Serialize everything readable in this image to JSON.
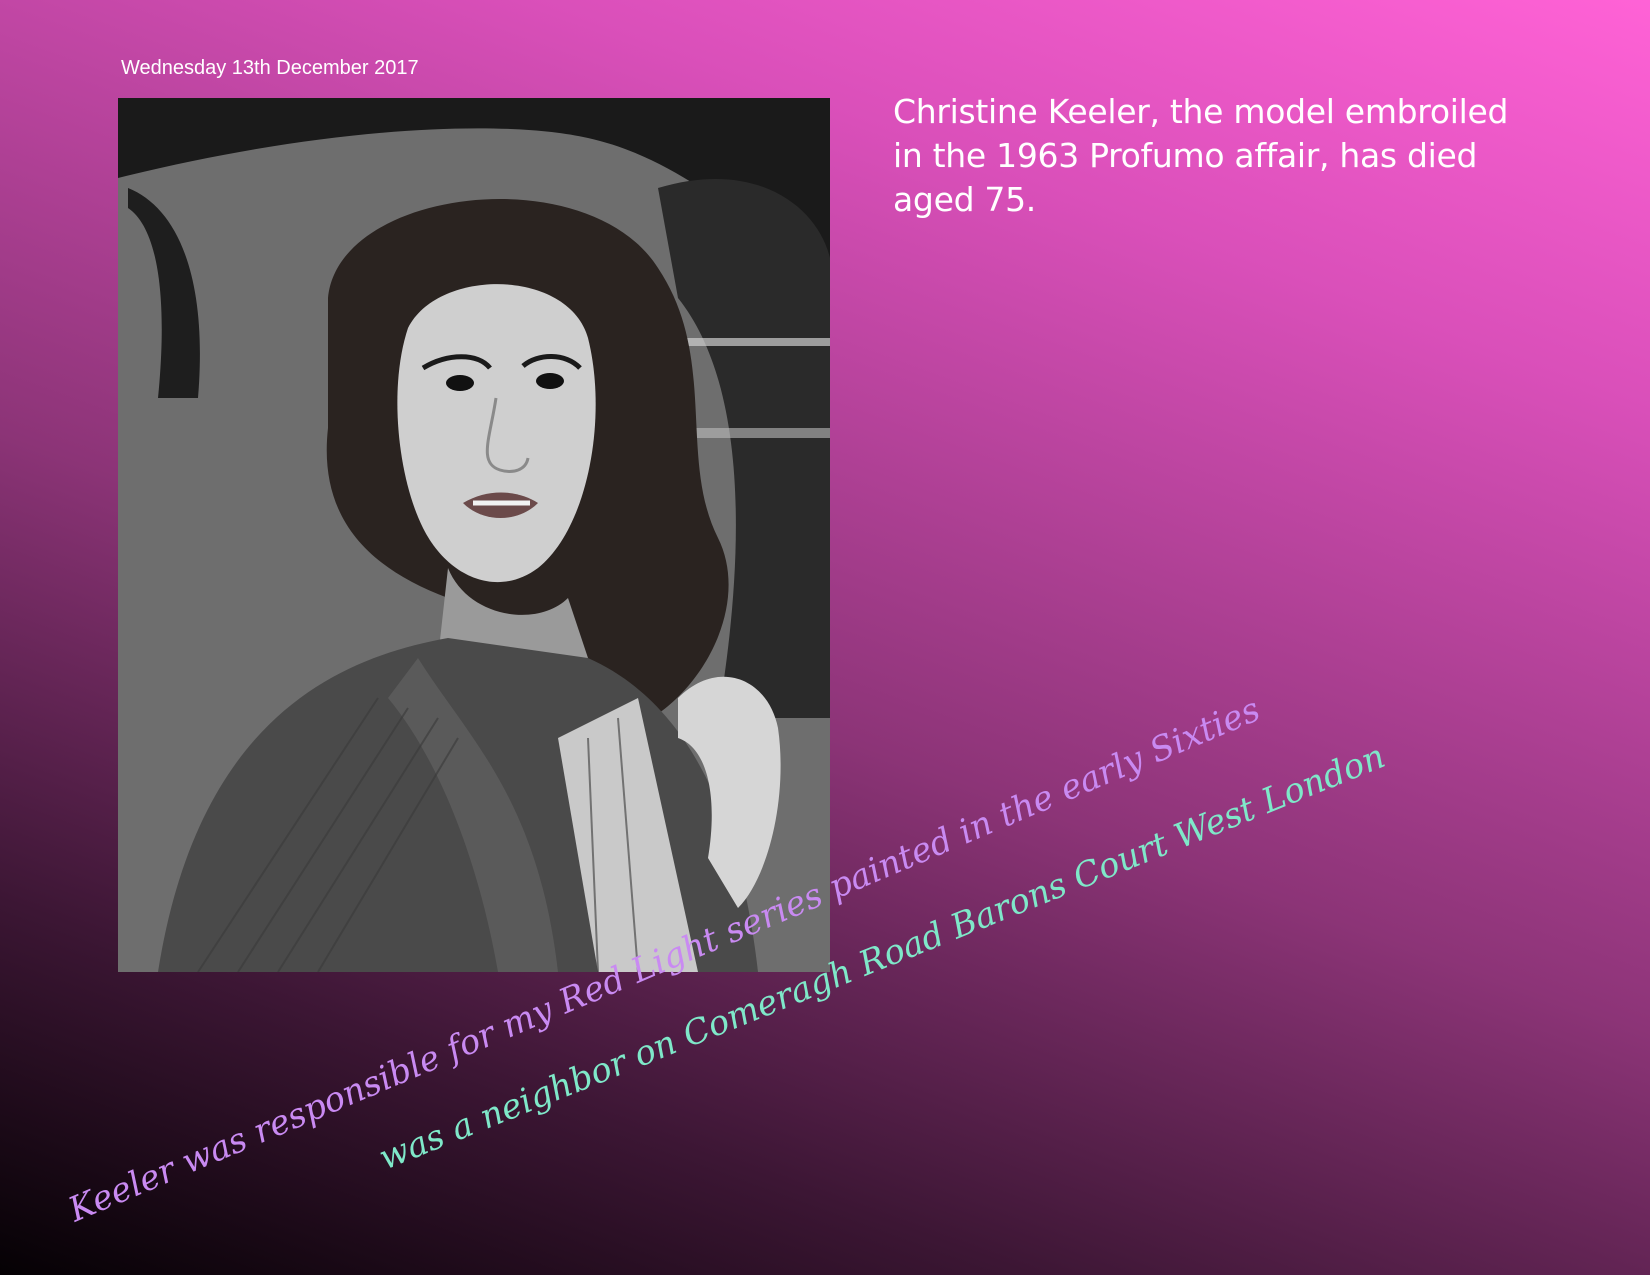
{
  "date": "Wednesday 13th December 2017",
  "headline": "Christine Keeler, the model embroiled in the 1963 Profumo affair, has died aged 75.",
  "caption_line_1": "Keeler was responsible for my Red Light series painted in the early Sixties",
  "caption_line_2": "was a neighbor on Comeragh Road Barons Court West London",
  "colors": {
    "caption_line_1": "#c98af2",
    "caption_line_2": "#7fe8c9",
    "headline": "#ffffff"
  }
}
